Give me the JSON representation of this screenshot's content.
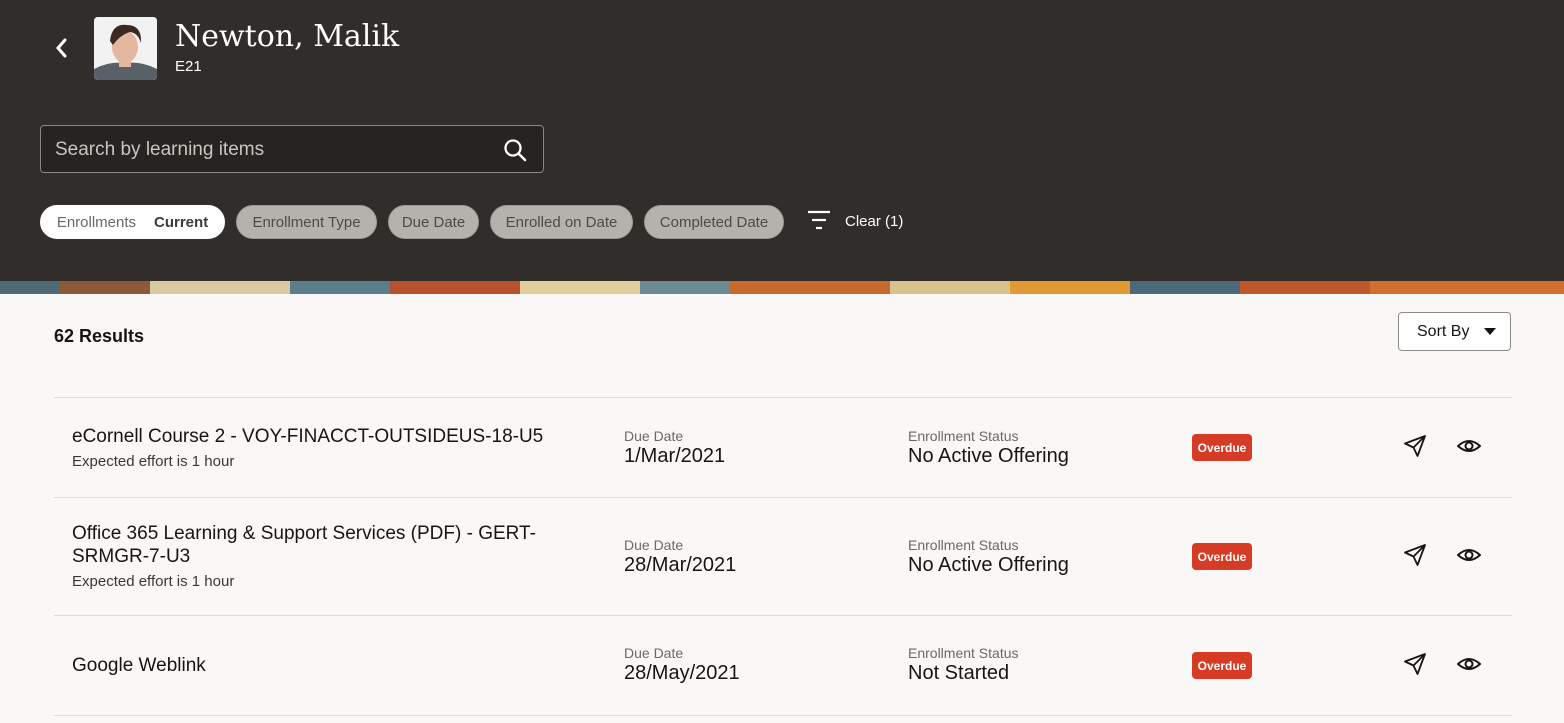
{
  "person": {
    "name": "Newton, Malik",
    "employee_id": "E21"
  },
  "search": {
    "placeholder": "Search by learning items"
  },
  "filters": {
    "enrollments": {
      "label": "Enrollments",
      "value": "Current"
    },
    "chips": [
      "Enrollment Type",
      "Due Date",
      "Enrolled on Date",
      "Completed Date"
    ],
    "clear_label": "Clear (1)"
  },
  "results": {
    "count_label": "62 Results",
    "sort_label": "Sort By"
  },
  "items": [
    {
      "title": "eCornell Course 2 - VOY-FINACCT-OUTSIDEUS-18-U5",
      "effort": "Expected effort is 1 hour",
      "due_label": "Due Date",
      "due_value": "1/Mar/2021",
      "status_label": "Enrollment Status",
      "status_value": "No Active Offering",
      "badge": "Overdue"
    },
    {
      "title": "Office 365 Learning & Support Services (PDF) - GERT-SRMGR-7-U3",
      "effort": "Expected effort is 1 hour",
      "due_label": "Due Date",
      "due_value": "28/Mar/2021",
      "status_label": "Enrollment Status",
      "status_value": "No Active Offering",
      "badge": "Overdue"
    },
    {
      "title": "Google Weblink",
      "effort": "",
      "due_label": "Due Date",
      "due_value": "28/May/2021",
      "status_label": "Enrollment Status",
      "status_value": "Not Started",
      "badge": "Overdue"
    }
  ],
  "colors": {
    "header_bg": "#312d2a",
    "badge_bg": "#d63b25",
    "page_bg": "#f9f8f6"
  }
}
